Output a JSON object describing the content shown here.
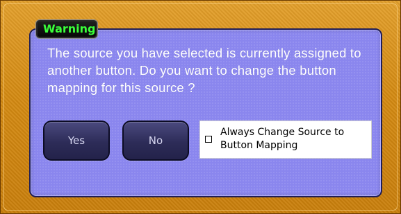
{
  "dialog": {
    "title": "Warning",
    "message": "The source you have selected is currently assigned to another button. Do you want to change the button mapping for this source ?",
    "buttons": {
      "yes": "Yes",
      "no": "No"
    },
    "checkbox": {
      "label": "Always Change Source to Button Mapping",
      "checked": false
    }
  },
  "colors": {
    "frame": "#d48a12",
    "panel": "#8a86ee",
    "title_text": "#3aff3a",
    "button_bg": "#2d2c58"
  }
}
